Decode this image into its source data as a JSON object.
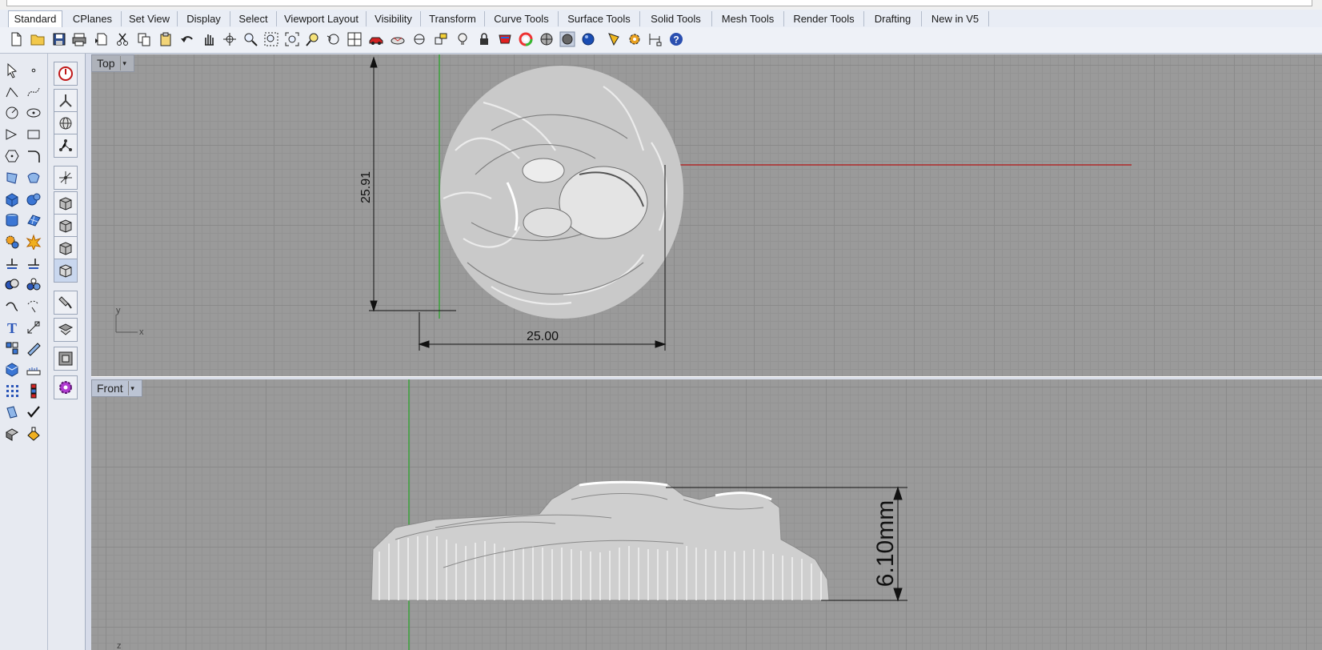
{
  "tabs": [
    "Standard",
    "CPlanes",
    "Set View",
    "Display",
    "Select",
    "Viewport Layout",
    "Visibility",
    "Transform",
    "Curve Tools",
    "Surface Tools",
    "Solid Tools",
    "Mesh Tools",
    "Render Tools",
    "Drafting",
    "New in V5"
  ],
  "active_tab": "Standard",
  "toolbar_icons": [
    "new-document-icon",
    "open-folder-icon",
    "save-icon",
    "print-icon",
    "import-icon",
    "cut-icon",
    "copy-icon",
    "paste-icon",
    "undo-icon",
    "pan-hand-icon",
    "rotate-view-icon",
    "zoom-icon",
    "zoom-window-icon",
    "zoom-extents-icon",
    "zoom-selected-icon",
    "undo-view-icon",
    "four-viewports-icon",
    "car-icon",
    "grid-snap-icon",
    "object-properties-icon",
    "cplane-icon",
    "light-bulb-icon",
    "lock-icon",
    "layer-icon",
    "color-wheel-icon",
    "shade-icon",
    "rendered-view-icon",
    "render-sphere-icon",
    "pen-icon",
    "gear-options-icon",
    "dimension-icon",
    "help-icon"
  ],
  "viewports": {
    "top": {
      "label": "Top",
      "dim_height": "25.91",
      "dim_width": "25.00",
      "axis_x": "x",
      "axis_y": "y"
    },
    "front": {
      "label": "Front",
      "dim_height": "6.10mm",
      "axis_z": "z"
    }
  },
  "colors": {
    "x_axis": "#b02a2a",
    "y_axis": "#3aa23a",
    "viewport_bg": "#9a9a9a"
  }
}
